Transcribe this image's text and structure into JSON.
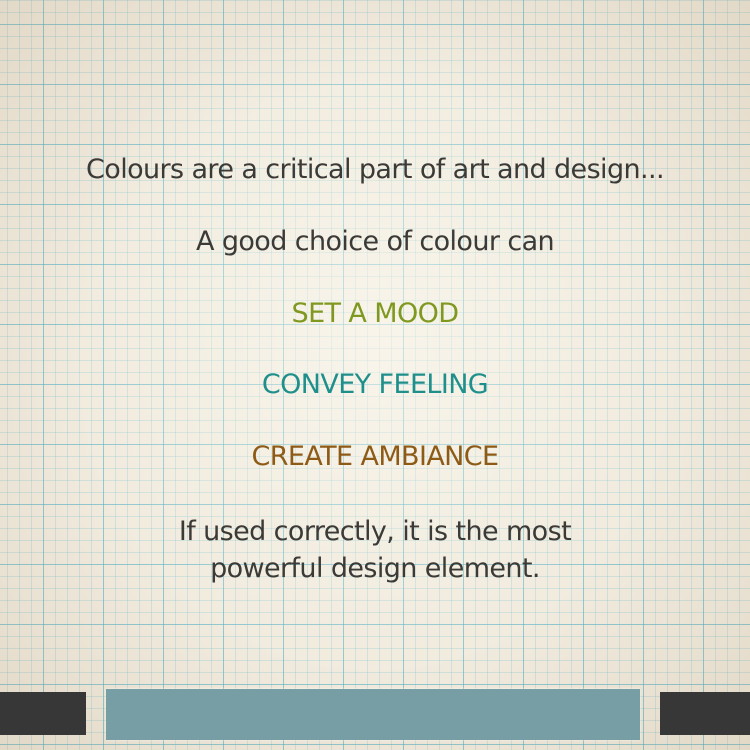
{
  "text": {
    "intro": "Colours are a critical part of art and design...",
    "choice": "A good choice of colour can",
    "mood": "SET A MOOD",
    "feeling": "CONVEY FEELING",
    "ambiance": "CREATE AMBIANCE",
    "closing_line1": "If used correctly, it is the most",
    "closing_line2": "powerful design element."
  },
  "colors": {
    "background": "#f1ebde",
    "grid": "#5cb2c4",
    "body_text": "#3c3a37",
    "mood": "#7f981f",
    "feeling": "#1f8f8c",
    "ambiance": "#8e5b17",
    "bar_dark": "#373737",
    "bar_center": "#769ea4"
  }
}
